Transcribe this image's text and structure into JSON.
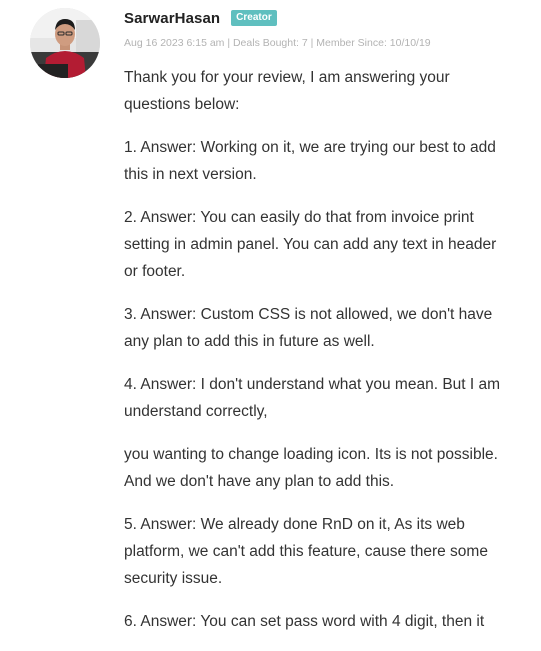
{
  "review": {
    "author": "SarwarHasan",
    "badge": "Creator",
    "meta": "Aug 16 2023 6:15 am | Deals Bought: 7 | Member Since: 10/10/19",
    "paragraphs": [
      "Thank you for your review, I am answering your questions below:",
      "1. Answer: Working on it, we are trying our best to add this in next version.",
      "2. Answer: You can easily do that from invoice print setting in admin panel. You can add any text in header or footer.",
      "3. Answer: Custom CSS is not allowed, we don't have any plan to add this in future as well.",
      "4. Answer: I don't understand what you mean. But I am understand correctly,",
      "you wanting to change loading icon. Its is not possi­ble. And we don't have any plan to add this.",
      "5. Answer: We already done RnD on it, As its web platform, we can't add this feature, cause there some security issue.",
      "6. Answer: You can set pass word with 4 digit, then it"
    ]
  },
  "colors": {
    "badge_bg": "#5fbfbf",
    "meta_text": "#b3b3b3",
    "body_text": "#333333"
  }
}
